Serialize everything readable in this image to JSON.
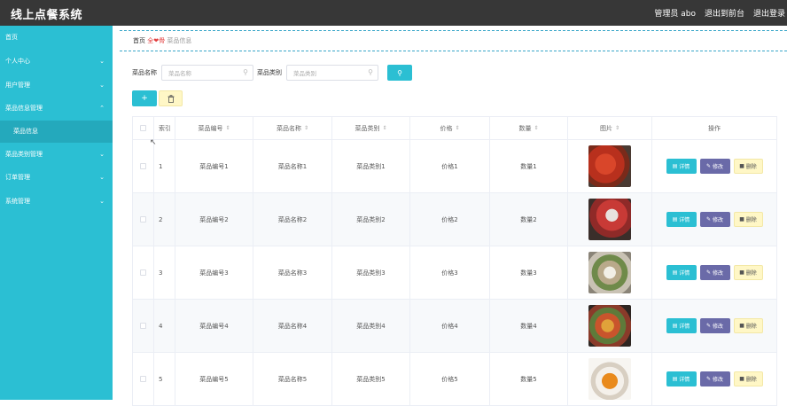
{
  "app": {
    "title": "线上点餐系统"
  },
  "top_links": {
    "admin": "管理员 abo",
    "to_frontend": "退出到前台",
    "logout": "退出登录"
  },
  "sidebar": {
    "items": [
      {
        "label": "首页",
        "has_chevron": false
      },
      {
        "label": "个人中心",
        "has_chevron": true
      },
      {
        "label": "用户管理",
        "has_chevron": true
      },
      {
        "label": "菜品信息管理",
        "has_chevron": true,
        "expanded": true
      },
      {
        "label": "菜品类别管理",
        "has_chevron": true
      },
      {
        "label": "订单管理",
        "has_chevron": true
      },
      {
        "label": "系统管理",
        "has_chevron": true
      }
    ],
    "sub_item": {
      "label": "菜品信息"
    }
  },
  "breadcrumb": {
    "home": "首页",
    "separator": "全❤骨",
    "current": "菜品信息"
  },
  "search": {
    "name_label": "菜品名称",
    "name_placeholder": "菜品名称",
    "category_label": "菜品类别",
    "category_placeholder": "菜品类别"
  },
  "toolbar": {
    "add_label": "+",
    "delete_icon": "trash-icon"
  },
  "table": {
    "headers": {
      "index": "索引",
      "code": "菜品编号",
      "name": "菜品名称",
      "category": "菜品类别",
      "price": "价格",
      "quantity": "数量",
      "image": "图片",
      "actions": "操作"
    },
    "rows": [
      {
        "index": "1",
        "code": "菜品编号1",
        "name": "菜品名称1",
        "category": "菜品类别1",
        "price": "价格1",
        "quantity": "数量1"
      },
      {
        "index": "2",
        "code": "菜品编号2",
        "name": "菜品名称2",
        "category": "菜品类别2",
        "price": "价格2",
        "quantity": "数量2"
      },
      {
        "index": "3",
        "code": "菜品编号3",
        "name": "菜品名称3",
        "category": "菜品类别3",
        "price": "价格3",
        "quantity": "数量3"
      },
      {
        "index": "4",
        "code": "菜品编号4",
        "name": "菜品名称4",
        "category": "菜品类别4",
        "price": "价格4",
        "quantity": "数量4"
      },
      {
        "index": "5",
        "code": "菜品编号5",
        "name": "菜品名称5",
        "category": "菜品类别5",
        "price": "价格5",
        "quantity": "数量5"
      }
    ],
    "actions": {
      "detail": "详情",
      "edit": "修改",
      "delete": "删除"
    }
  },
  "colors": {
    "accent": "#2bbfd3",
    "edit": "#6a6aa8",
    "danger_bg": "#fff7c6",
    "topbar": "#373737"
  }
}
